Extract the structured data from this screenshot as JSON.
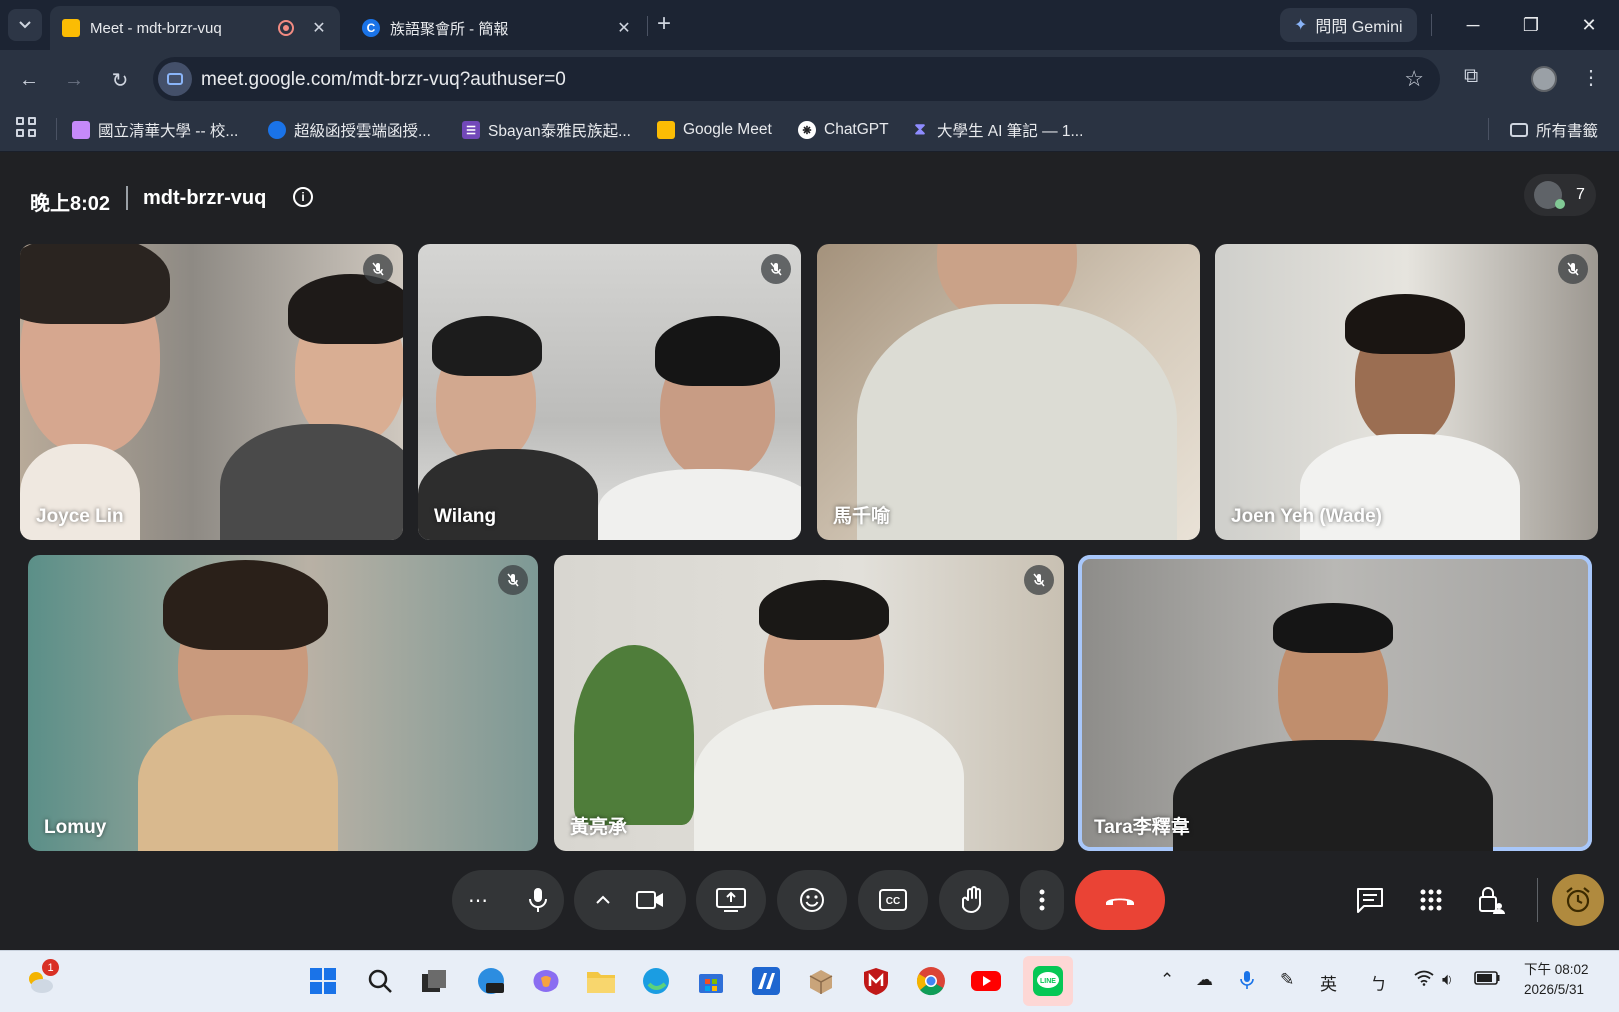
{
  "browser": {
    "tabs": [
      {
        "title": "Meet - mdt-brzr-vuq",
        "active": true
      },
      {
        "title": "族語聚會所 - 簡報",
        "active": false
      }
    ],
    "gemini_label": "問問 Gemini",
    "url": "meet.google.com/mdt-brzr-vuq?authuser=0",
    "bookmarks": [
      {
        "label": "國立清華大學 -- 校...",
        "icon": "nthu-icon"
      },
      {
        "label": "超級函授雲端函授...",
        "icon": "cloud-icon"
      },
      {
        "label": "Sbayan泰雅民族起...",
        "icon": "list-icon"
      },
      {
        "label": "Google Meet",
        "icon": "meet-icon"
      },
      {
        "label": "ChatGPT",
        "icon": "chatgpt-icon"
      },
      {
        "label": "大學生 AI 筆記 — 1...",
        "icon": "hourglass-icon"
      }
    ],
    "all_bookmarks_label": "所有書籤"
  },
  "meet": {
    "time": "晚上8:02",
    "meeting_code": "mdt-brzr-vuq",
    "participant_count": "7",
    "participants": [
      {
        "name": "Joyce Lin",
        "muted": true
      },
      {
        "name": "Wilang",
        "muted": true
      },
      {
        "name": "馬千喻",
        "muted": false
      },
      {
        "name": "Joen Yeh (Wade)",
        "muted": true
      },
      {
        "name": "Lomuy",
        "muted": true
      },
      {
        "name": "黃亮承",
        "muted": true
      },
      {
        "name": "Tara李釋韋",
        "muted": false,
        "speaking": true
      }
    ]
  },
  "taskbar": {
    "notification_badge": "1",
    "tray_ime": "英",
    "clock_time": "下午 08:02",
    "clock_date": "2026/5/31"
  },
  "colors": {
    "end_call": "#ea4335",
    "speaking_border": "#a8c7fa",
    "meet_bg": "#202124"
  }
}
